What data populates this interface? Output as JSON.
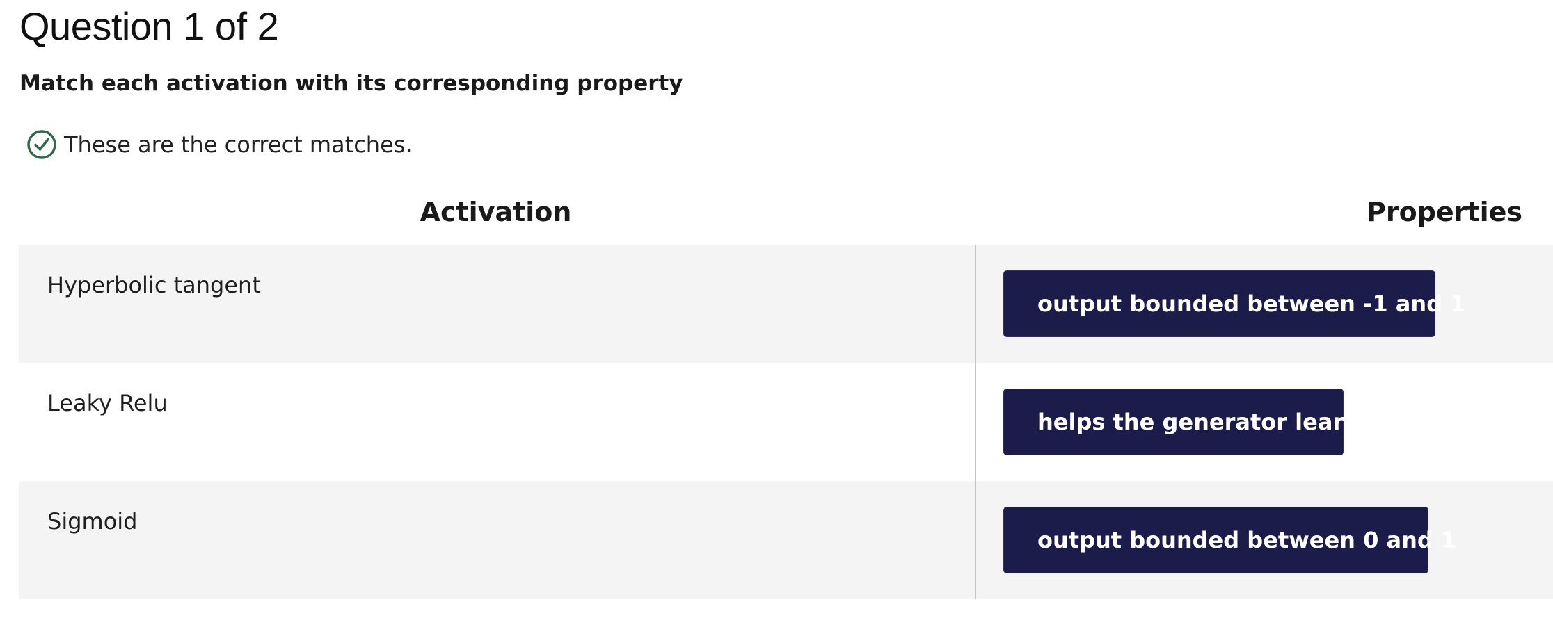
{
  "question": {
    "title": "Question 1 of 2",
    "prompt": "Match each activation with its corresponding property"
  },
  "feedback": {
    "status": "correct",
    "icon": "check-circle-icon",
    "text": "These are the correct matches.",
    "color": "#2e6b4a"
  },
  "table": {
    "headers": {
      "activation": "Activation",
      "properties": "Properties"
    },
    "rows": [
      {
        "activation": "Hyperbolic tangent",
        "property": "output bounded between -1 and 1"
      },
      {
        "activation": "Leaky Relu",
        "property": "helps the generator learn"
      },
      {
        "activation": "Sigmoid",
        "property": "output bounded between 0 and 1"
      }
    ]
  },
  "colors": {
    "chip_background": "#1b1c4a",
    "shaded_row": "#f4f4f4",
    "divider": "#c4c4c4"
  }
}
